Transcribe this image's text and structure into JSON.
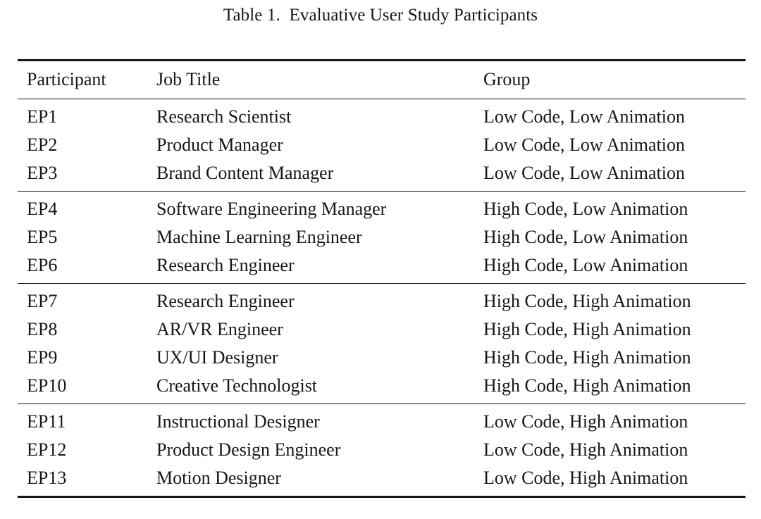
{
  "caption": {
    "label": "Table 1.  Evaluative User Study Participants",
    "number": "Table 1.",
    "title": "Evaluative User Study Participants"
  },
  "table": {
    "columns": [
      "Participant",
      "Job Title",
      "Group"
    ],
    "groups": [
      {
        "group_label": "Low Code, Low Animation",
        "rows": [
          {
            "participant": "EP1",
            "job_title": "Research Scientist",
            "group": "Low Code, Low Animation"
          },
          {
            "participant": "EP2",
            "job_title": "Product Manager",
            "group": "Low Code, Low Animation"
          },
          {
            "participant": "EP3",
            "job_title": "Brand Content Manager",
            "group": "Low Code, Low Animation"
          }
        ]
      },
      {
        "group_label": "High Code, Low Animation",
        "rows": [
          {
            "participant": "EP4",
            "job_title": "Software Engineering Manager",
            "group": "High Code, Low Animation"
          },
          {
            "participant": "EP5",
            "job_title": "Machine Learning Engineer",
            "group": "High Code, Low Animation"
          },
          {
            "participant": "EP6",
            "job_title": "Research Engineer",
            "group": "High Code, Low Animation"
          }
        ]
      },
      {
        "group_label": "High Code, High Animation",
        "rows": [
          {
            "participant": "EP7",
            "job_title": "Research Engineer",
            "group": "High Code, High Animation"
          },
          {
            "participant": "EP8",
            "job_title": "AR/VR Engineer",
            "group": "High Code, High Animation"
          },
          {
            "participant": "EP9",
            "job_title": "UX/UI Designer",
            "group": "High Code, High Animation"
          },
          {
            "participant": "EP10",
            "job_title": "Creative Technologist",
            "group": "High Code, High Animation"
          }
        ]
      },
      {
        "group_label": "Low Code, High Animation",
        "rows": [
          {
            "participant": "EP11",
            "job_title": "Instructional Designer",
            "group": "Low Code, High Animation"
          },
          {
            "participant": "EP12",
            "job_title": "Product Design Engineer",
            "group": "Low Code, High Animation"
          },
          {
            "participant": "EP13",
            "job_title": "Motion Designer",
            "group": "Low Code, High Animation"
          }
        ]
      }
    ]
  },
  "style": {
    "text_color": "#15171a",
    "background": "#ffffff",
    "rule_color": "#15171a"
  }
}
